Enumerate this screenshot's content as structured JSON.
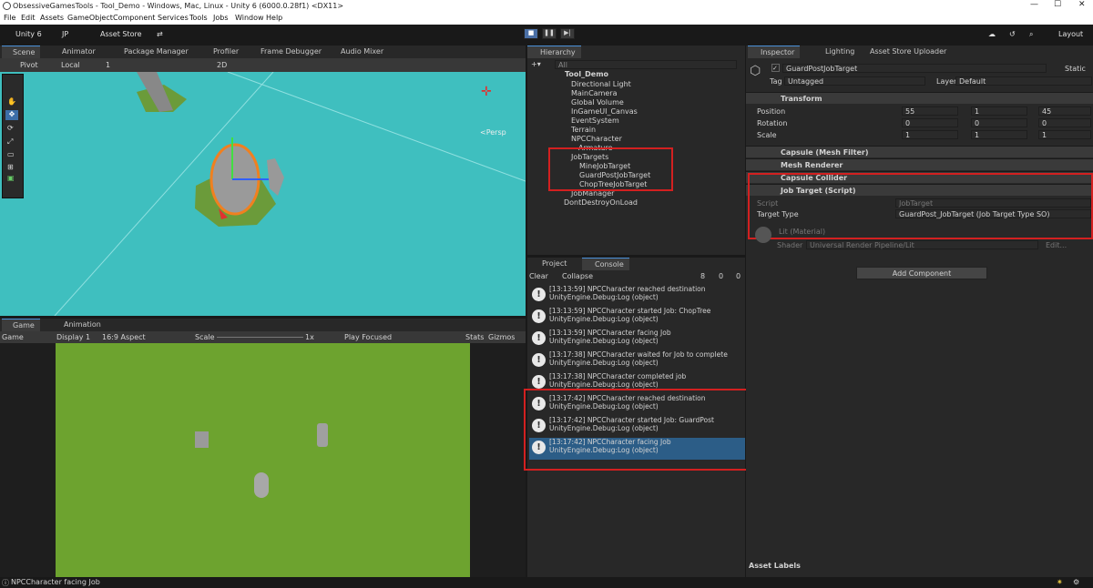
{
  "window": {
    "title": "ObsessiveGamesTools - Tool_Demo - Windows, Mac, Linux - Unity 6 (6000.0.28f1) <DX11>"
  },
  "menu": [
    "File",
    "Edit",
    "Assets",
    "GameObject",
    "Component",
    "Services",
    "Tools",
    "Jobs",
    "Window",
    "Help"
  ],
  "toolbar": {
    "unity": "Unity 6",
    "account": "JP",
    "store": "Asset Store",
    "layout": "Layout"
  },
  "scene_tabs": [
    "Scene",
    "Animator",
    "Package Manager",
    "Profiler",
    "Frame Debugger",
    "Audio Mixer"
  ],
  "scene_toolbar": {
    "pivot": "Pivot",
    "local": "Local",
    "grid": "1",
    "mode": "2D",
    "persp": "<Persp"
  },
  "game_tabs": [
    "Game",
    "Animation"
  ],
  "game_toolbar": {
    "game": "Game",
    "display": "Display 1",
    "aspect": "16:9 Aspect",
    "scale": "Scale",
    "scale_val": "1x",
    "play_focused": "Play Focused",
    "stats": "Stats",
    "gizmos": "Gizmos"
  },
  "hierarchy": {
    "title": "Hierarchy",
    "search": "All",
    "items": [
      "Tool_Demo",
      "Directional Light",
      "MainCamera",
      "Global Volume",
      "InGameUI_Canvas",
      "EventSystem",
      "Terrain",
      "NPCCharacter",
      "Armature",
      "JobTargets",
      "MineJobTarget",
      "GuardPostJobTarget",
      "ChopTreeJobTarget",
      "JobManager",
      "DontDestroyOnLoad"
    ]
  },
  "console": {
    "tabs": [
      "Project",
      "Console"
    ],
    "clear": "Clear",
    "collapse": "Collapse",
    "counts": [
      "8",
      "0",
      "0"
    ],
    "logs": [
      {
        "line1": "[13:13:59] NPCCharacter reached destination",
        "line2": "UnityEngine.Debug:Log (object)"
      },
      {
        "line1": "[13:13:59] NPCCharacter started Job: ChopTree",
        "line2": "UnityEngine.Debug:Log (object)"
      },
      {
        "line1": "[13:13:59] NPCCharacter facing Job",
        "line2": "UnityEngine.Debug:Log (object)"
      },
      {
        "line1": "[13:17:38] NPCCharacter waited for Job to complete",
        "line2": "UnityEngine.Debug:Log (object)"
      },
      {
        "line1": "[13:17:38] NPCCharacter completed job",
        "line2": "UnityEngine.Debug:Log (object)"
      },
      {
        "line1": "[13:17:42] NPCCharacter reached destination",
        "line2": "UnityEngine.Debug:Log (object)"
      },
      {
        "line1": "[13:17:42] NPCCharacter started Job: GuardPost",
        "line2": "UnityEngine.Debug:Log (object)"
      },
      {
        "line1": "[13:17:42] NPCCharacter facing Job",
        "line2": "UnityEngine.Debug:Log (object)"
      }
    ]
  },
  "inspector": {
    "tabs": [
      "Inspector",
      "Lighting",
      "Asset Store Uploader"
    ],
    "object_name": "GuardPostJobTarget",
    "static": "Static",
    "tag_label": "Tag",
    "tag": "Untagged",
    "layer_label": "Layer",
    "layer": "Default",
    "transform": "Transform",
    "position_label": "Position",
    "rotation_label": "Rotation",
    "scale_label": "Scale",
    "position": [
      "55",
      "1",
      "45"
    ],
    "rotation": [
      "0",
      "0",
      "0"
    ],
    "scale": [
      "1",
      "1",
      "1"
    ],
    "components": [
      "Capsule (Mesh Filter)",
      "Mesh Renderer",
      "Capsule Collider",
      "Job Target (Script)"
    ],
    "script_label": "Script",
    "script_value": "JobTarget",
    "target_type_label": "Target Type",
    "target_type_value": "GuardPost_JobTarget (Job Target Type SO)",
    "material": "Lit (Material)",
    "shader_label": "Shader",
    "shader_value": "Universal Render Pipeline/Lit",
    "edit": "Edit...",
    "add_component": "Add Component",
    "asset_labels": "Asset Labels"
  },
  "status": "NPCCharacter facing Job",
  "colors": {
    "highlight": "#d32020",
    "selected": "#2c5d87",
    "scene_bg": "#3fbfbf",
    "game_grass": "#6da32f"
  }
}
